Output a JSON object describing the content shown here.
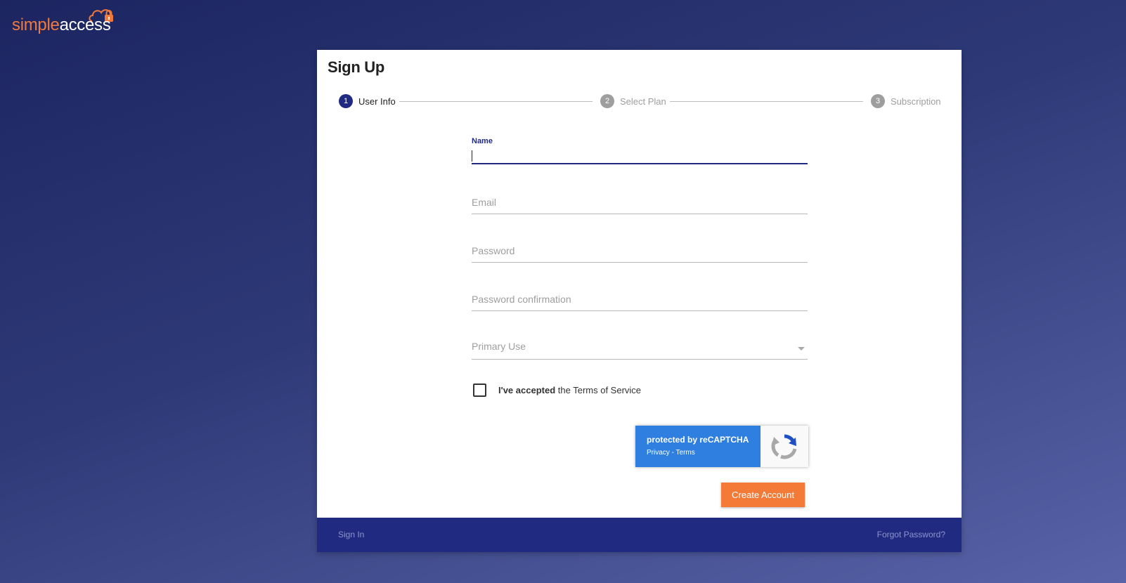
{
  "brand": {
    "name_part1": "simple",
    "name_part2": "access",
    "accent": "#f07a3e"
  },
  "card": {
    "title": "Sign Up"
  },
  "stepper": {
    "steps": [
      {
        "number": "1",
        "label": "User Info",
        "state": "active"
      },
      {
        "number": "2",
        "label": "Select Plan",
        "state": "inactive"
      },
      {
        "number": "3",
        "label": "Subscription",
        "state": "inactive"
      }
    ]
  },
  "form": {
    "name": {
      "label": "Name",
      "value": ""
    },
    "email": {
      "placeholder": "Email",
      "value": ""
    },
    "password": {
      "placeholder": "Password",
      "value": ""
    },
    "password_confirmation": {
      "placeholder": "Password confirmation",
      "value": ""
    },
    "primary_use": {
      "placeholder": "Primary Use"
    },
    "terms": {
      "prefix": "I've accepted",
      "suffix": "the Terms of Service",
      "checked": false
    }
  },
  "recaptcha": {
    "title": "protected by reCAPTCHA",
    "privacy": "Privacy",
    "separator": " - ",
    "terms": "Terms"
  },
  "actions": {
    "create_account": "Create Account"
  },
  "footer": {
    "sign_in": "Sign In",
    "forgot_password": "Forgot Password?"
  },
  "colors": {
    "primary": "#1f2a80",
    "accent": "#f47a38",
    "recaptcha": "#2f7fe0"
  }
}
